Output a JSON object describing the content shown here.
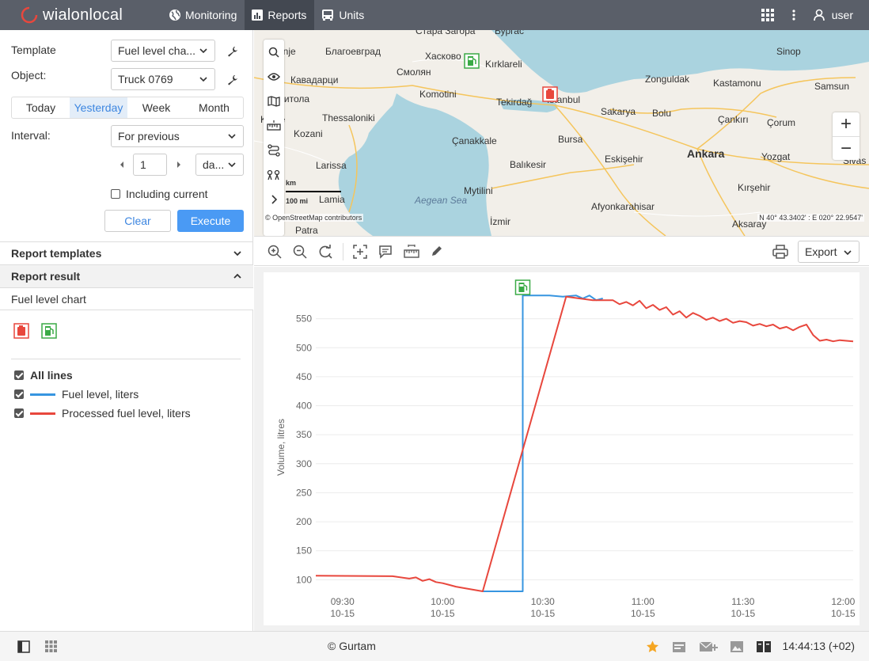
{
  "app": {
    "logo_brand": "wialon",
    "logo_suffix": "local",
    "nav": [
      {
        "label": "Monitoring",
        "icon": "globe-icon"
      },
      {
        "label": "Reports",
        "icon": "report-icon",
        "active": true
      },
      {
        "label": "Units",
        "icon": "bus-icon"
      }
    ],
    "user": "user"
  },
  "form": {
    "template_label": "Template",
    "template_value": "Fuel level cha...",
    "object_label": "Object:",
    "object_value": "Truck 0769",
    "periods": [
      "Today",
      "Yesterday",
      "Week",
      "Month"
    ],
    "period_selected": "Yesterday",
    "interval_label": "Interval:",
    "interval_value": "For previous",
    "interval_count": "1",
    "interval_unit": "da...",
    "including_current": "Including current",
    "clear": "Clear",
    "execute": "Execute"
  },
  "sections": {
    "templates": "Report templates",
    "result": "Report result",
    "result_item": "Fuel level chart"
  },
  "legend": {
    "all": "All lines",
    "lines": [
      {
        "label": "Fuel level, liters",
        "color": "#3795e0"
      },
      {
        "label": "Processed fuel level, liters",
        "color": "#e8473d"
      }
    ]
  },
  "map": {
    "labels": [
      {
        "text": "Стара Загора",
        "cls": "l1"
      },
      {
        "text": "Бургас",
        "cls": "l2"
      },
      {
        "text": "Konje",
        "cls": "l3"
      },
      {
        "text": "Благоевград",
        "cls": "l4"
      },
      {
        "text": "Хасково",
        "cls": "l5"
      },
      {
        "text": "Kırklareli",
        "cls": "l6"
      },
      {
        "text": "Sinop",
        "cls": "l7"
      },
      {
        "text": "Смолян",
        "cls": "l8"
      },
      {
        "text": "Кавадарци",
        "cls": "l9"
      },
      {
        "text": "Komotini",
        "cls": "l10"
      },
      {
        "text": "Zonguldak",
        "cls": "l11"
      },
      {
        "text": "Kastamonu",
        "cls": "l12"
      },
      {
        "text": "Samsun",
        "cls": "l13"
      },
      {
        "text": "Tekirdağ",
        "cls": "l14"
      },
      {
        "text": "İstanbul",
        "cls": "l15"
      },
      {
        "text": "Битола",
        "cls": "l16"
      },
      {
        "text": "Thessaloniki",
        "cls": "l17"
      },
      {
        "text": "Sakarya",
        "cls": "l18"
      },
      {
        "text": "Bolu",
        "cls": "l19"
      },
      {
        "text": "Çankırı",
        "cls": "l20"
      },
      {
        "text": "Çorum",
        "cls": "l21"
      },
      {
        "text": "Korçë",
        "cls": "l22"
      },
      {
        "text": "Kozani",
        "cls": "l23"
      },
      {
        "text": "Çanakkale",
        "cls": "l24"
      },
      {
        "text": "Bursa",
        "cls": "l25"
      },
      {
        "text": "Ankara",
        "cls": "l26"
      },
      {
        "text": "Yozgat",
        "cls": "l27"
      },
      {
        "text": "Eskişehir",
        "cls": "l28"
      },
      {
        "text": "Balıkesir",
        "cls": "l29"
      },
      {
        "text": "Sivas",
        "cls": "l30"
      },
      {
        "text": "Larissa",
        "cls": "l31"
      },
      {
        "text": "Kırşehir",
        "cls": "l32"
      },
      {
        "text": "Mytilini",
        "cls": "l33"
      },
      {
        "text": "Aegean Sea",
        "cls": "l34"
      },
      {
        "text": "Lamia",
        "cls": "l35"
      },
      {
        "text": "Afyonkarahisar",
        "cls": "l36"
      },
      {
        "text": "Patra",
        "cls": "l37"
      },
      {
        "text": "İzmir",
        "cls": "l38"
      },
      {
        "text": "Aksaray",
        "cls": "l39"
      }
    ],
    "scale_km": "km",
    "scale_mi": "100 mi",
    "attribution": "© OpenStreetMap contributors",
    "coords": "N 40° 43.3402' : E 020° 22.9547'",
    "zoom_in": "+",
    "zoom_out": "−"
  },
  "chart_toolbar": {
    "export": "Export"
  },
  "chart_data": {
    "type": "line",
    "ylabel": "Volume, litres",
    "ylim": [
      80,
      600
    ],
    "yticks": [
      100,
      150,
      200,
      250,
      300,
      350,
      400,
      450,
      500,
      550
    ],
    "xlim": [
      "09:22",
      "12:03"
    ],
    "xticks": [
      {
        "time": "09:30",
        "date": "10-15"
      },
      {
        "time": "10:00",
        "date": "10-15"
      },
      {
        "time": "10:30",
        "date": "10-15"
      },
      {
        "time": "11:00",
        "date": "10-15"
      },
      {
        "time": "11:30",
        "date": "10-15"
      },
      {
        "time": "12:00",
        "date": "10-15"
      }
    ],
    "series": [
      {
        "name": "Fuel level, liters",
        "color": "#3795e0",
        "points": [
          [
            "10:12",
            80
          ],
          [
            "10:24",
            80
          ],
          [
            "10:24",
            590
          ],
          [
            "10:32",
            590
          ],
          [
            "10:36",
            588
          ],
          [
            "10:40",
            590
          ],
          [
            "10:42",
            585
          ],
          [
            "10:44",
            590
          ],
          [
            "10:46",
            582
          ],
          [
            "10:48",
            585
          ]
        ]
      },
      {
        "name": "Processed fuel level, liters",
        "color": "#e8473d",
        "points": [
          [
            "09:22",
            107
          ],
          [
            "09:45",
            106
          ],
          [
            "09:50",
            102
          ],
          [
            "09:52",
            104
          ],
          [
            "09:54",
            98
          ],
          [
            "09:56",
            101
          ],
          [
            "09:58",
            96
          ],
          [
            "10:00",
            94
          ],
          [
            "10:02",
            91
          ],
          [
            "10:04",
            88
          ],
          [
            "10:06",
            86
          ],
          [
            "10:12",
            80
          ],
          [
            "10:37",
            588
          ],
          [
            "10:45",
            582
          ],
          [
            "10:51",
            582
          ],
          [
            "10:53",
            575
          ],
          [
            "10:55",
            579
          ],
          [
            "10:57",
            573
          ],
          [
            "10:59",
            581
          ],
          [
            "11:01",
            568
          ],
          [
            "11:03",
            574
          ],
          [
            "11:05",
            565
          ],
          [
            "11:07",
            570
          ],
          [
            "11:09",
            557
          ],
          [
            "11:11",
            563
          ],
          [
            "11:13",
            552
          ],
          [
            "11:15",
            560
          ],
          [
            "11:17",
            555
          ],
          [
            "11:19",
            548
          ],
          [
            "11:21",
            552
          ],
          [
            "11:23",
            546
          ],
          [
            "11:25",
            550
          ],
          [
            "11:27",
            543
          ],
          [
            "11:29",
            546
          ],
          [
            "11:31",
            544
          ],
          [
            "11:33",
            538
          ],
          [
            "11:35",
            541
          ],
          [
            "11:37",
            537
          ],
          [
            "11:39",
            540
          ],
          [
            "11:41",
            533
          ],
          [
            "11:43",
            536
          ],
          [
            "11:45",
            530
          ],
          [
            "11:47",
            536
          ],
          [
            "11:49",
            540
          ],
          [
            "11:51",
            522
          ],
          [
            "11:53",
            512
          ],
          [
            "11:55",
            514
          ],
          [
            "11:57",
            511
          ],
          [
            "11:59",
            513
          ],
          [
            "12:03",
            511
          ]
        ]
      }
    ],
    "markers": [
      {
        "type": "refuel",
        "time": "10:24",
        "color": "#3aaa46"
      }
    ]
  },
  "footer": {
    "copyright": "© Gurtam",
    "time": "14:44:13 (+02)"
  }
}
